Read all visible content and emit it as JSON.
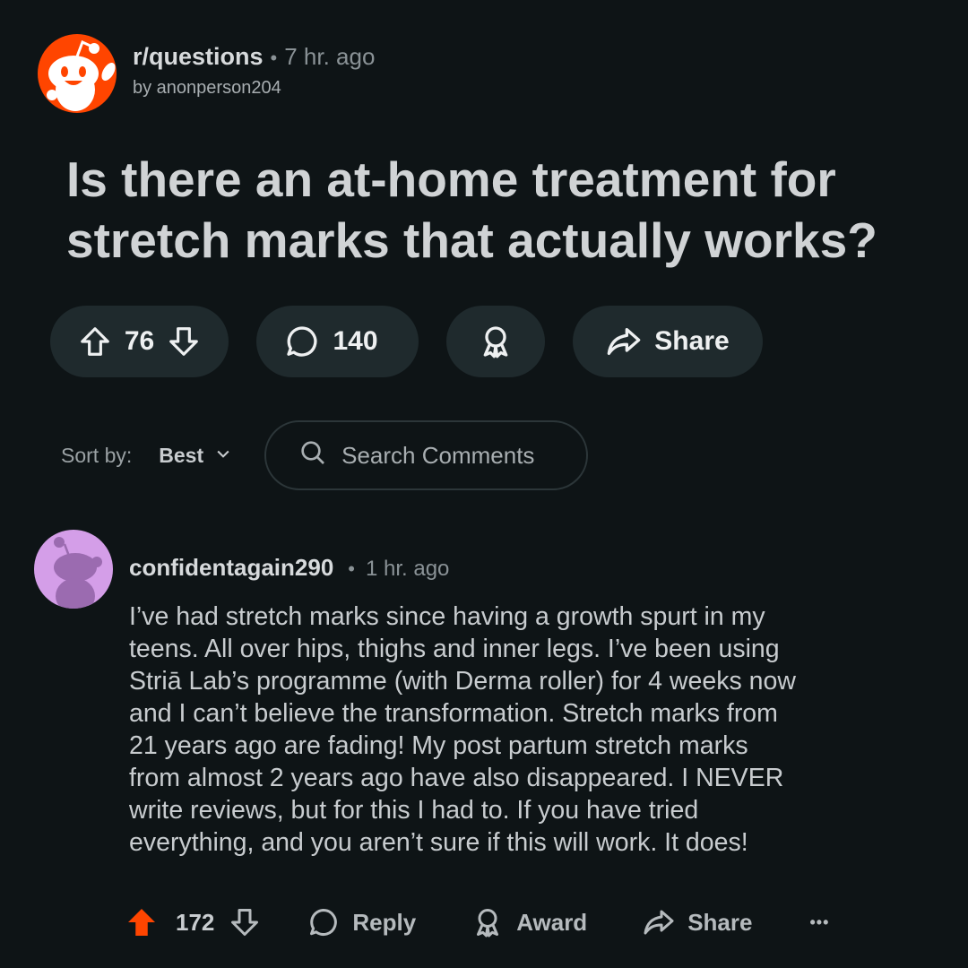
{
  "post": {
    "subreddit": "r/questions",
    "separator": "•",
    "time": "7 hr. ago",
    "byline": "by anonperson204",
    "title": "Is there an at-home treatment for stretch marks that actually works?",
    "votes": "76",
    "comments": "140",
    "share_label": "Share"
  },
  "sort": {
    "label": "Sort by:",
    "value": "Best"
  },
  "search": {
    "placeholder": "Search Comments"
  },
  "comment": {
    "user": "confidentagain290",
    "separator": "•",
    "time": "1 hr. ago",
    "body": "I’ve had stretch marks since having a growth spurt in my\nteens. All over hips, thighs and inner legs. I’ve been using\nStriā Lab’s programme (with Derma roller) for 4 weeks now\nand I can’t believe the transformation. Stretch marks from\n21 years ago are fading! My post partum stretch marks\nfrom almost 2 years ago have also disappeared. I NEVER\nwrite reviews, but for this I had to. If you have tried\neverything, and you aren’t sure if this will work. It does!",
    "score": "172",
    "reply_label": "Reply",
    "award_label": "Award",
    "share_label": "Share",
    "more_label": "•••"
  },
  "icons": {
    "upvote": "upvote-icon",
    "downvote": "downvote-icon",
    "comment": "comment-bubble-icon",
    "award": "award-icon",
    "share": "share-arrow-icon",
    "search": "search-icon",
    "chevron": "chevron-down-icon",
    "more": "more-icon"
  },
  "colors": {
    "background": "#0e1416",
    "pill": "#1f2a2d",
    "subreddit_avatar": "#ff4500",
    "user_avatar": "#d49ee8",
    "upvoted": "#ff4500"
  }
}
